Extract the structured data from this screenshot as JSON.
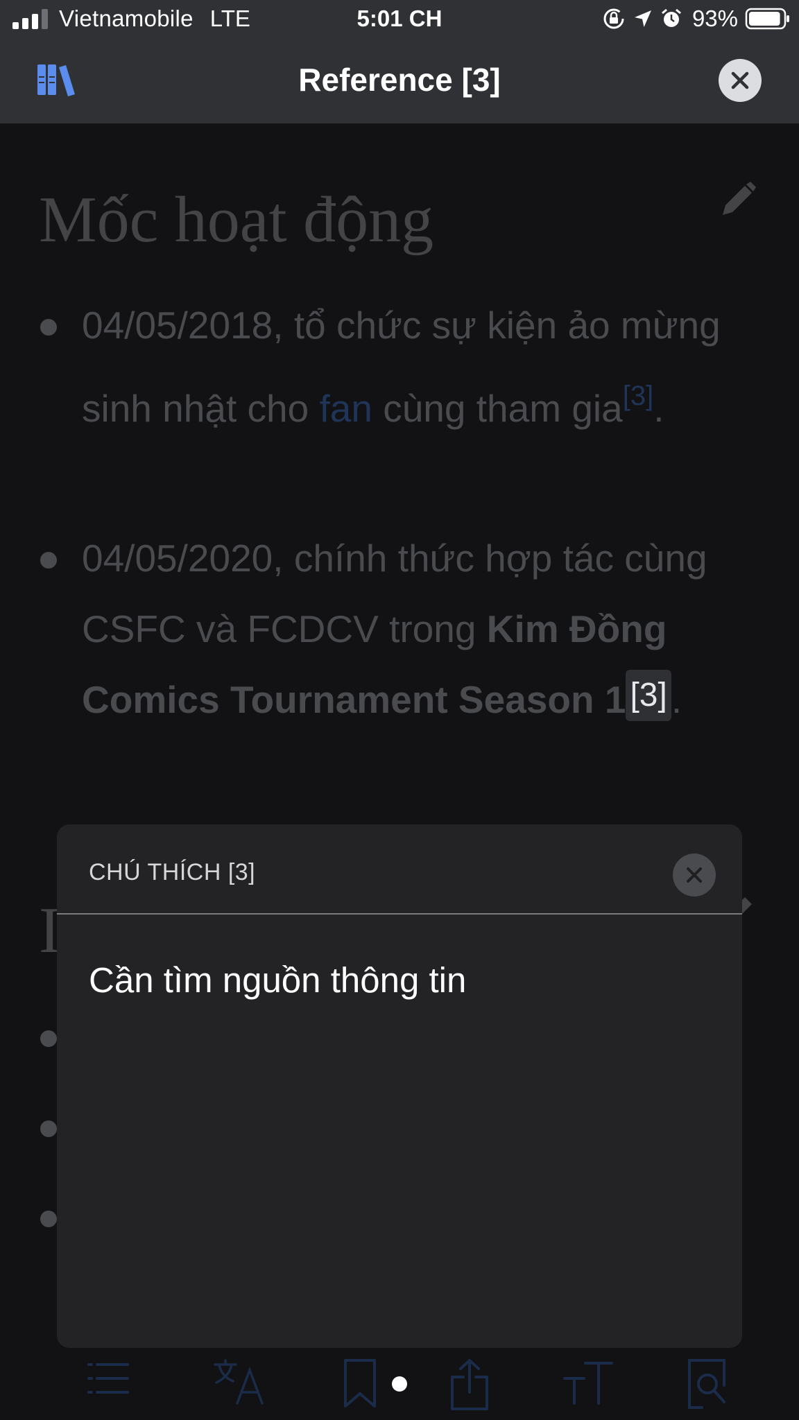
{
  "status_bar": {
    "carrier": "Vietnamobile",
    "network": "LTE",
    "time": "5:01 CH",
    "battery": "93%",
    "battery_level": 0.93,
    "signal_bars": 4,
    "icons": [
      "orientation-lock-icon",
      "location-arrow-icon",
      "alarm-icon",
      "battery-icon"
    ]
  },
  "nav": {
    "title": "Reference [3]",
    "left_icon": "library-icon",
    "right_icon": "close-icon"
  },
  "article": {
    "heading": "Mốc hoạt động",
    "item1": {
      "text_a": "04/05/2018, tổ chức sự kiện ảo mừng sinh nhật cho ",
      "link": "fan",
      "text_b": " cùng tham gia",
      "ref": "[3]",
      "end": "."
    },
    "item2": {
      "text_a": "04/05/2020, chính thức hợp tác cùng CSFC và FCDCV trong ",
      "bold": "Kim Đồng Comics Tournament Season 1",
      "ref": "[3]",
      "end": "."
    },
    "heading2": "I"
  },
  "popover": {
    "title": "CHÚ THÍCH [3]",
    "body": "Cần tìm nguồn thông tin"
  },
  "toolbar": {
    "icons": [
      "contents-icon",
      "language-icon",
      "bookmark-icon",
      "share-icon",
      "text-size-icon",
      "find-in-page-icon"
    ]
  },
  "colors": {
    "bar_bg": "#2f3135",
    "page_bg": "#121214",
    "popover_bg": "#232325",
    "link": "#1f3558",
    "accent": "#5b8def"
  }
}
